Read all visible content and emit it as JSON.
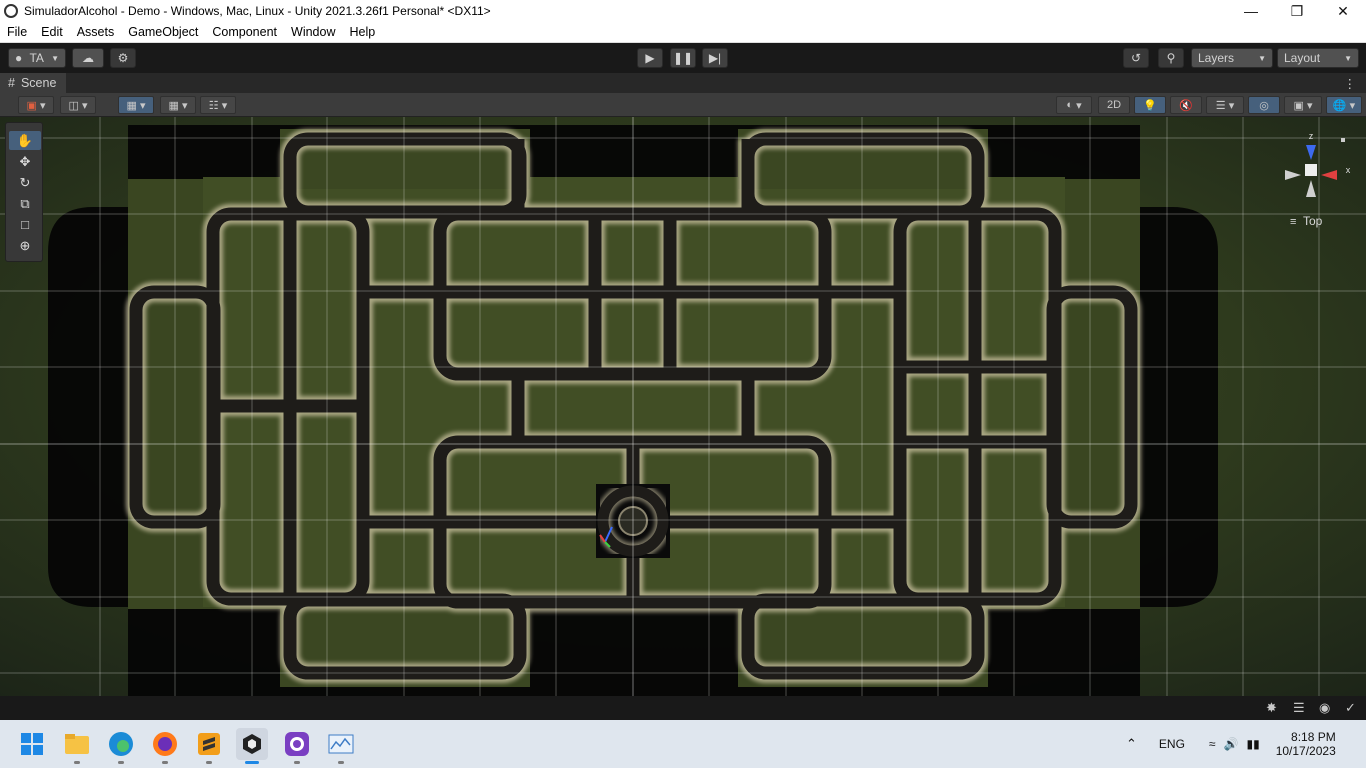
{
  "window": {
    "title": "SimuladorAlcohol - Demo - Windows, Mac, Linux - Unity 2021.3.26f1 Personal* <DX11>",
    "controls": [
      "minimize",
      "restore",
      "close"
    ]
  },
  "menu": {
    "items": [
      "File",
      "Edit",
      "Assets",
      "GameObject",
      "Component",
      "Window",
      "Help"
    ]
  },
  "toolbar": {
    "account_label": "TA",
    "layers_label": "Layers",
    "layout_label": "Layout"
  },
  "scene": {
    "tab_label": "Scene",
    "mode_2d_label": "2D",
    "gizmo": {
      "axis_z": "z",
      "axis_x": "x",
      "view_label": "Top"
    }
  },
  "taskbar": {
    "language": "ENG",
    "time": "8:18 PM",
    "date": "10/17/2023"
  },
  "colors": {
    "editor_bg": "#191919",
    "panel_bg": "#3c3c3c",
    "active_blue": "#46607c",
    "road_glow": "#c8bfa0",
    "grass": "#39471f",
    "taskbar_bg": "#dfe6ee"
  }
}
